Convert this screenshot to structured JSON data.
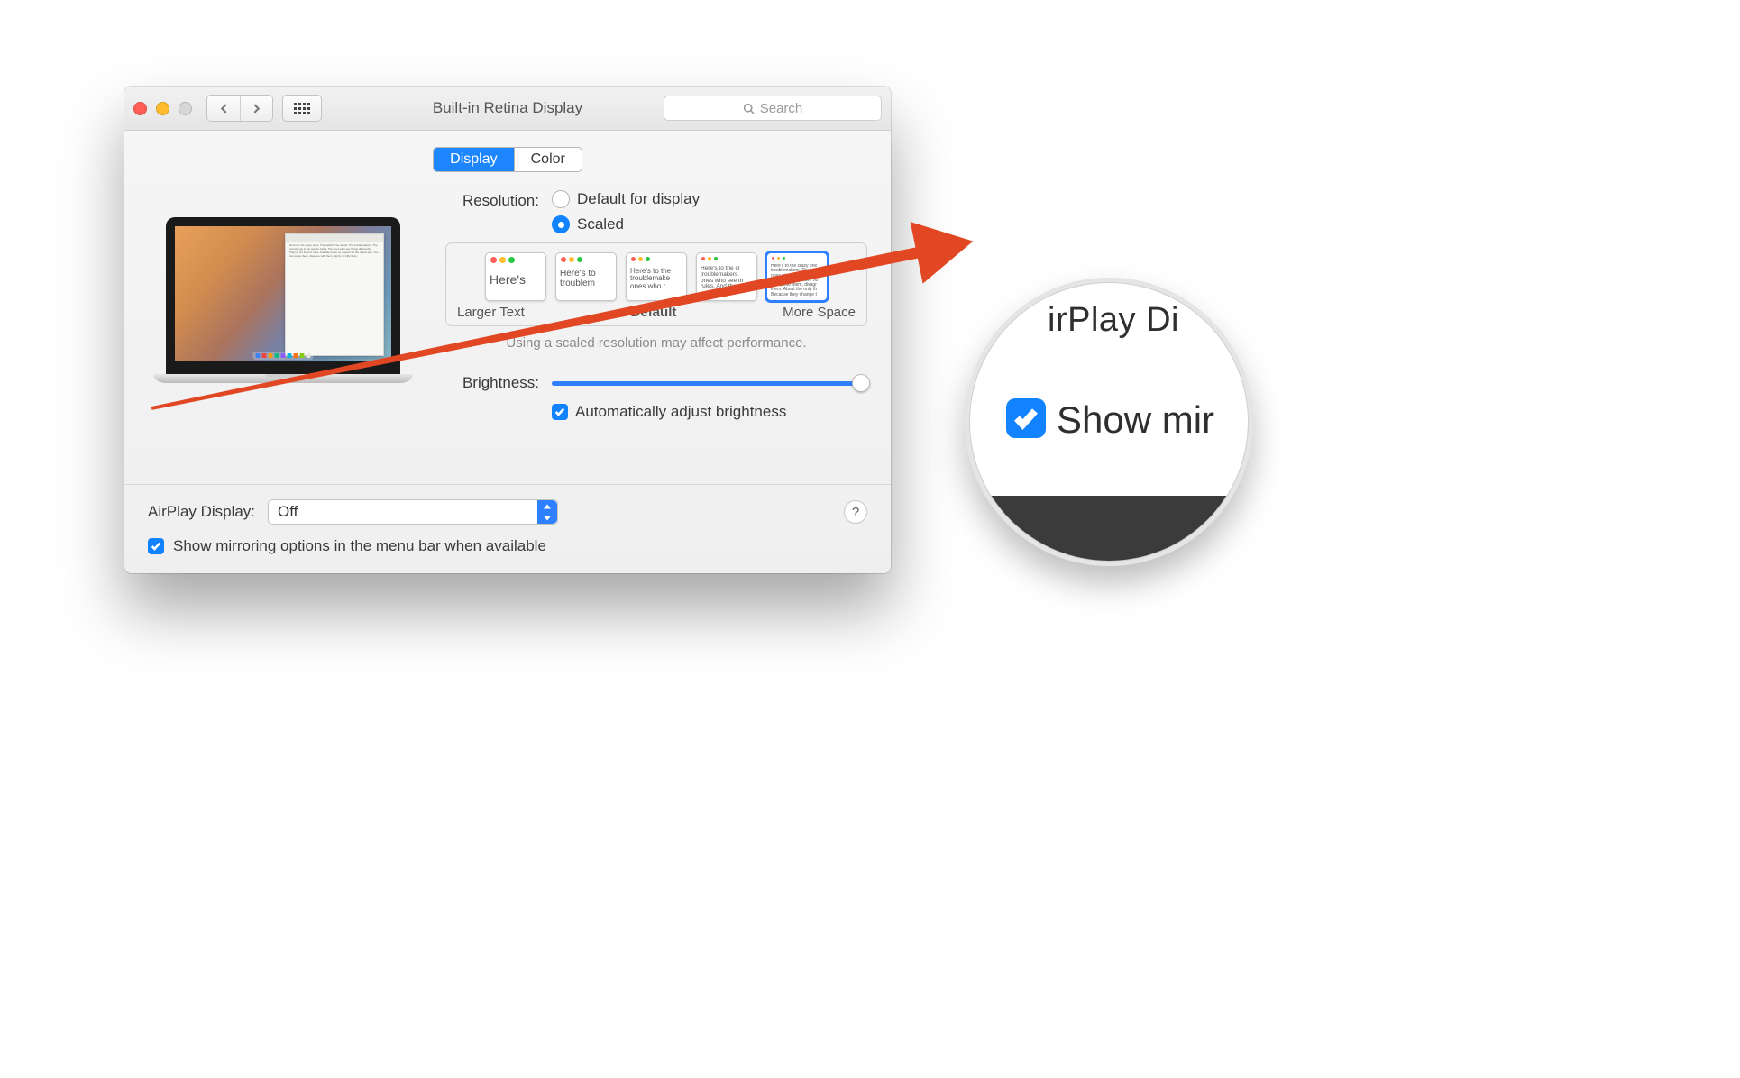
{
  "window": {
    "title": "Built-in Retina Display"
  },
  "search": {
    "placeholder": "Search"
  },
  "tabs": {
    "display": "Display",
    "color": "Color",
    "active": "display"
  },
  "resolution": {
    "label": "Resolution:",
    "default": "Default for display",
    "scaled": "Scaled",
    "selected": "scaled"
  },
  "scale_options": {
    "larger_caption": "Larger Text",
    "default_caption": "Default",
    "more_caption": "More Space",
    "card1": "Here's",
    "card2": "Here's to troublem",
    "card3": "Here's to the troublemake ones who r",
    "card4": "Here's to the cr troublemakers. ones who see th rules. And they",
    "card5": "Here's to the crazy one troublemakers. The rou ones who see things di rules. And they have no can quote them, disagr them. About the only th Because they change t"
  },
  "perf_note": "Using a scaled resolution may affect performance.",
  "brightness": {
    "label": "Brightness:",
    "pct": 98,
    "auto": "Automatically adjust brightness"
  },
  "airplay": {
    "label": "AirPlay Display:",
    "value": "Off"
  },
  "mirror": "Show mirroring options in the menu bar when available",
  "magnifier": {
    "top": "irPlay Di",
    "show": "Show mir"
  },
  "colors": {
    "accent": "#1283ff",
    "arrow": "#e04722"
  }
}
